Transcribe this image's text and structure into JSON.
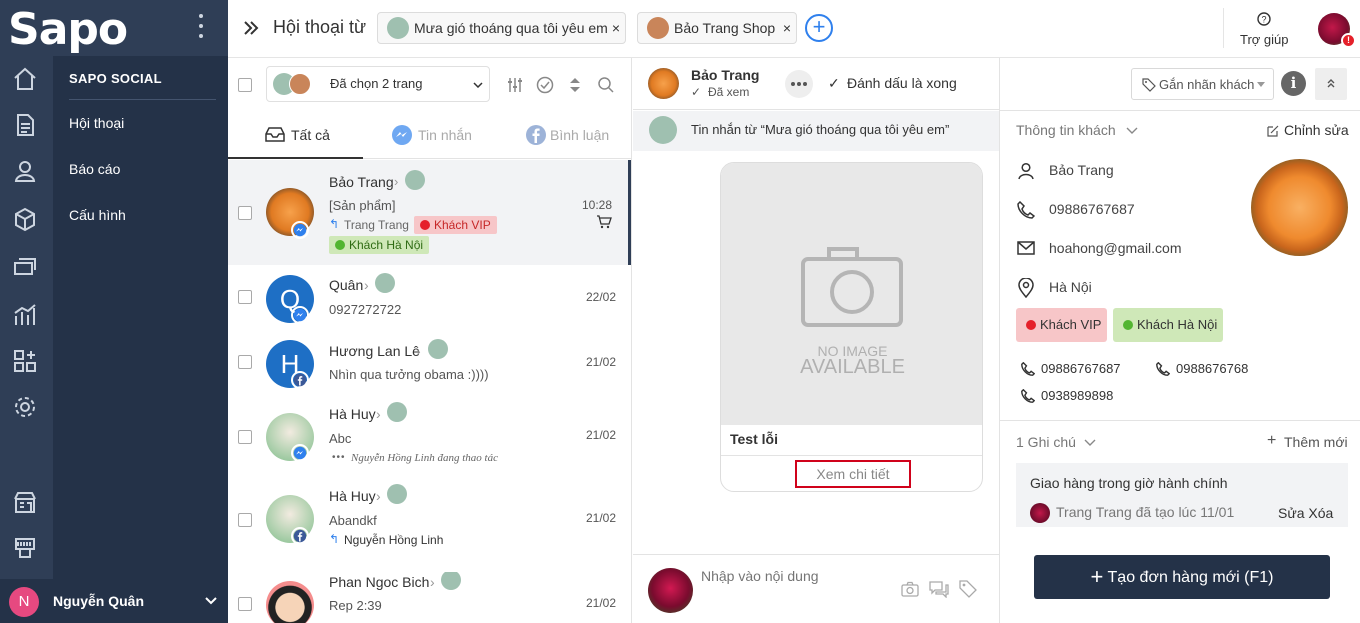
{
  "app": {
    "logo": "Sapo",
    "user_initial": "N",
    "user_name": "Nguyễn Quân"
  },
  "menu": {
    "header": "SAPO SOCIAL",
    "items": [
      {
        "label": "Hội thoại"
      },
      {
        "label": "Báo cáo"
      },
      {
        "label": "Cấu hình"
      }
    ]
  },
  "rail_icons": [
    "home-icon",
    "document-icon",
    "user-icon",
    "box-icon",
    "money-icon",
    "chart-icon",
    "apps-icon",
    "settings-icon",
    "store-icon",
    "pos-icon"
  ],
  "topbar": {
    "title": "Hội thoại từ",
    "tabs": [
      {
        "label": "Mưa gió thoáng qua tôi yêu em"
      },
      {
        "label": "Bảo Trang Shop"
      }
    ],
    "help": "Trợ giúp"
  },
  "list": {
    "selected_label": "Đã chọn 2 trang",
    "tabs": [
      {
        "label": "Tất cả"
      },
      {
        "label": "Tin nhắn"
      },
      {
        "label": "Bình luận"
      }
    ],
    "conversations": [
      {
        "name": "Bảo Trang",
        "preview": "[Sản phẩm]",
        "date": "10:28",
        "assignee": "Trang Trang",
        "tags": [
          "Khách VIP",
          "Khách Hà Nội"
        ]
      },
      {
        "name": "Quân",
        "initial": "Q",
        "preview": "0927272722",
        "date": "22/02"
      },
      {
        "name": "Hương Lan Lê",
        "initial": "H",
        "preview": "Nhìn qua tưởng obama :))))",
        "date": "21/02"
      },
      {
        "name": "Hà Huy",
        "preview": "Abc",
        "date": "21/02",
        "typing": "Nguyễn Hồng Linh đang thao tác"
      },
      {
        "name": "Hà Huy",
        "preview": "Abandkf",
        "date": "21/02",
        "assignee": "Nguyễn Hồng Linh"
      },
      {
        "name": "Phan Ngoc Bich",
        "preview": "Rep 2:39",
        "date": "21/02"
      }
    ]
  },
  "chat": {
    "name": "Bảo Trang",
    "status": "Đã xem",
    "mark_done": "Đánh dấu là xong",
    "tag_placeholder": "Gắn nhãn khách",
    "source": "Tin nhắn từ  “Mưa gió thoáng qua tôi yêu em”",
    "card": {
      "no_image_1": "NO IMAGE",
      "no_image_2": "AVAILABLE",
      "title": "Test lỗi",
      "button": "Xem chi tiết"
    },
    "input_placeholder": "Nhập vào nội dung"
  },
  "info": {
    "header": "Thông tin khách",
    "edit": "Chỉnh sửa",
    "name": "Bảo Trang",
    "phone": "09886767687",
    "email": "hoahong@gmail.com",
    "location": "Hà Nội",
    "tags": [
      "Khách VIP",
      "Khách Hà Nội"
    ],
    "phones": [
      "09886767687",
      "0988676768",
      "0938989898"
    ],
    "notes_header": "1 Ghi chú",
    "add_new": "Thêm mới",
    "note_text": "Giao hàng trong giờ hành chính",
    "note_meta": "Trang Trang đã tạo lúc 11/01",
    "note_actions": "Sửa Xóa",
    "create_order": "Tạo đơn hàng mới (F1)"
  },
  "colors": {
    "sidebar": "#2f3e56",
    "submenu": "#243248",
    "accent": "#2f80ed",
    "vip": "#f7c6c8",
    "hanoi": "#cfe8b8",
    "red_dot": "#e5202a",
    "green_dot": "#52b531",
    "order_button": "#243248",
    "highlight_box": "#d0021b"
  }
}
